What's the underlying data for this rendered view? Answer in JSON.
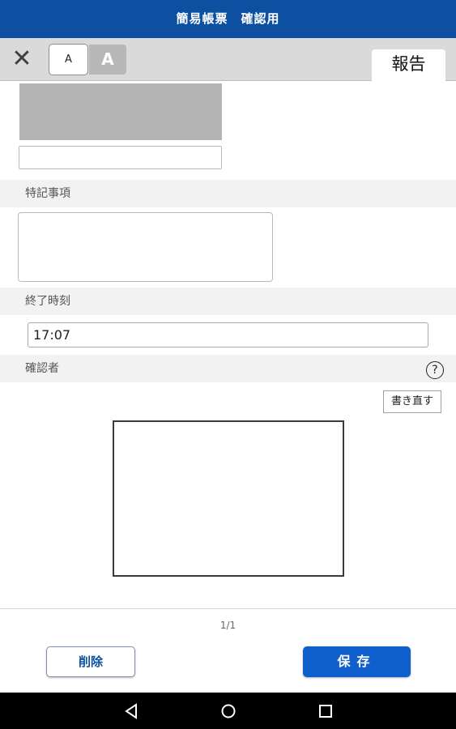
{
  "header": {
    "title": "簡易帳票　確認用"
  },
  "toolbar": {
    "close_icon": "close-icon",
    "font_small_label": "A",
    "font_large_label": "A",
    "tab_label": "報告"
  },
  "sections": {
    "notes_label": "特記事項",
    "end_time_label": "終了時刻",
    "end_time_value": "17:07",
    "confirmer_label": "確認者",
    "help_symbol": "?",
    "rewrite_label": "書き直す"
  },
  "footer": {
    "page_indicator": "1/1",
    "delete_label": "削除",
    "save_label": "保存"
  },
  "colors": {
    "primary": "#0d4fa0",
    "save_button": "#0f5fcc",
    "toolbar": "#dadada"
  }
}
